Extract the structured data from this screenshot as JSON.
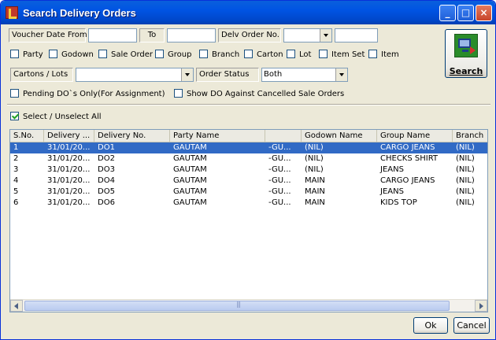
{
  "window": {
    "title": "Search Delivery Orders",
    "controls": {
      "minimize": "_",
      "maximize": "□",
      "close": "×"
    }
  },
  "filters": {
    "voucher_date_from_label": "Voucher Date From",
    "voucher_date_from_value": "",
    "to_label": "To",
    "to_value": "",
    "delv_order_no_label": "Delv Order No.",
    "delv_order_no_select": "",
    "delv_order_no_value": "",
    "checkboxes": [
      {
        "label": "Party",
        "checked": false
      },
      {
        "label": "Godown",
        "checked": false
      },
      {
        "label": "Sale Order",
        "checked": false
      },
      {
        "label": "Group",
        "checked": false
      },
      {
        "label": "Branch",
        "checked": false
      },
      {
        "label": "Carton",
        "checked": false
      },
      {
        "label": "Lot",
        "checked": false
      },
      {
        "label": "Item Set",
        "checked": false
      },
      {
        "label": "Item",
        "checked": false
      }
    ],
    "cartons_lots_label": "Cartons / Lots",
    "cartons_lots_value": "",
    "order_status_label": "Order Status",
    "order_status_value": "Both",
    "pending_do_label": "Pending DO`s Only(For Assignment)",
    "pending_do_checked": false,
    "show_cancelled_label": "Show DO Against Cancelled Sale Orders",
    "show_cancelled_checked": false
  },
  "search_button": {
    "label": "Search",
    "icon": "computer-search-icon"
  },
  "select_all": {
    "label": "Select / Unselect All",
    "checked": true
  },
  "table": {
    "columns": [
      "S.No.",
      "Delivery ...",
      "Delivery No.",
      "Party Name",
      "",
      "Godown Name",
      "Group Name",
      "Branch"
    ],
    "rows": [
      [
        "1",
        "31/01/20...",
        "DO1",
        "GAUTAM",
        "-GU...",
        "(NIL)",
        "CARGO JEANS",
        "(NIL)"
      ],
      [
        "2",
        "31/01/20...",
        "DO2",
        "GAUTAM",
        "-GU...",
        "(NIL)",
        "CHECKS SHIRT",
        "(NIL)"
      ],
      [
        "3",
        "31/01/20...",
        "DO3",
        "GAUTAM",
        "-GU...",
        "(NIL)",
        "JEANS",
        "(NIL)"
      ],
      [
        "4",
        "31/01/20...",
        "DO4",
        "GAUTAM",
        "-GU...",
        "MAIN",
        "CARGO JEANS",
        "(NIL)"
      ],
      [
        "5",
        "31/01/20...",
        "DO5",
        "GAUTAM",
        "-GU...",
        "MAIN",
        "JEANS",
        "(NIL)"
      ],
      [
        "6",
        "31/01/20...",
        "DO6",
        "GAUTAM",
        "-GU...",
        "MAIN",
        "KIDS TOP",
        "(NIL)"
      ]
    ],
    "selected_row": 1
  },
  "footer": {
    "ok_label": "Ok",
    "cancel_label": "Cancel"
  },
  "colors": {
    "titlebar": "#0054E3",
    "selection": "#316AC5",
    "dialog_bg": "#ECE9D8"
  }
}
